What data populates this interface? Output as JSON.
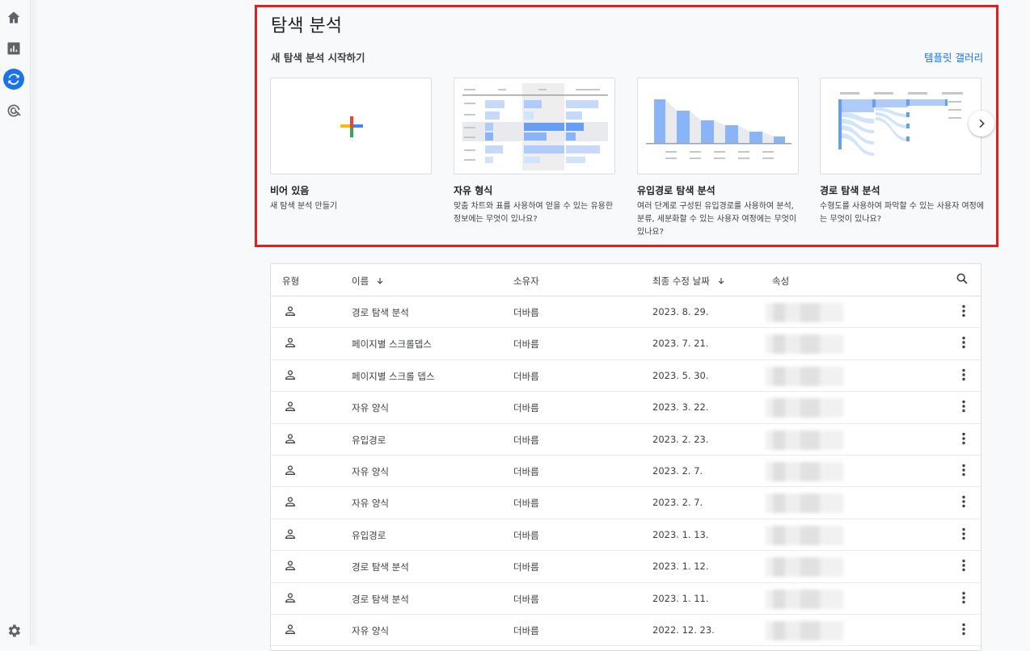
{
  "page": {
    "title": "탐색 분석",
    "subtitle": "새 탐색 분석 시작하기",
    "gallery_link": "템플릿 갤러리"
  },
  "templates": [
    {
      "title": "비어 있음",
      "desc": "새 탐색 분석 만들기",
      "icon": "plus-icon"
    },
    {
      "title": "자유 형식",
      "desc": "맞춤 차트와 표를 사용하여 얻을 수 있는 유용한 정보에는 무엇이 있나요?",
      "icon": "freeform-thumbnail"
    },
    {
      "title": "유입경로 탐색 분석",
      "desc": "여러 단계로 구성된 유입경로를 사용하여 분석, 분류, 세분화할 수 있는 사용자 여정에는 무엇이 있나요?",
      "icon": "funnel-thumbnail"
    },
    {
      "title": "경로 탐색 분석",
      "desc": "수형도를 사용하여 파악할 수 있는 사용자 여정에는 무엇이 있나요?",
      "icon": "path-thumbnail"
    }
  ],
  "table": {
    "headers": {
      "type": "유형",
      "name": "이름",
      "owner": "소유자",
      "modified": "최종 수정 날짜",
      "property": "속성"
    },
    "rows": [
      {
        "name": "경로 탐색 분석",
        "owner": "더바름",
        "date": "2023. 8. 29."
      },
      {
        "name": "페이지별 스크롤뎁스",
        "owner": "더바름",
        "date": "2023. 7. 21."
      },
      {
        "name": "페이지별 스크롤 뎁스",
        "owner": "더바름",
        "date": "2023. 5. 30."
      },
      {
        "name": "자유 양식",
        "owner": "더바름",
        "date": "2023. 3. 22."
      },
      {
        "name": "유입경로",
        "owner": "더바름",
        "date": "2023. 2. 23."
      },
      {
        "name": "자유 양식",
        "owner": "더바름",
        "date": "2023. 2. 7."
      },
      {
        "name": "자유 양식",
        "owner": "더바름",
        "date": "2023. 2. 7."
      },
      {
        "name": "유입경로",
        "owner": "더바름",
        "date": "2023. 1. 13."
      },
      {
        "name": "경로 탐색 분석",
        "owner": "더바름",
        "date": "2023. 1. 12."
      },
      {
        "name": "경로 탐색 분석",
        "owner": "더바름",
        "date": "2023. 1. 11."
      },
      {
        "name": "자유 양식",
        "owner": "더바름",
        "date": "2022. 12. 23."
      }
    ]
  },
  "colors": {
    "accent": "#1a73e8",
    "highlight": "#e0201f"
  }
}
